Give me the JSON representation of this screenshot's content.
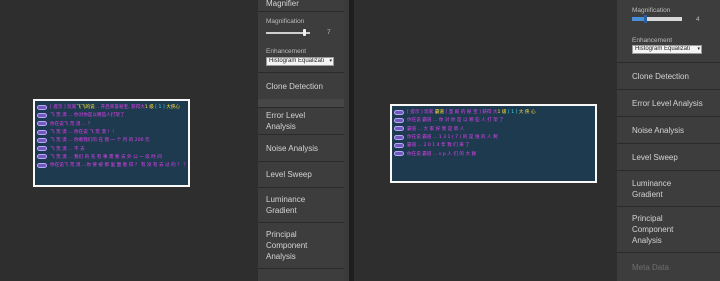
{
  "left_panel": {
    "header_partial": "Magnifier",
    "magnification": {
      "label": "Magnification",
      "value": "7"
    },
    "enhancement": {
      "label": "Enhancement",
      "selected": "Histogram Equalizati"
    },
    "tools": [
      "Clone Detection",
      "Error Level Analysis",
      "Noise Analysis",
      "Level Sweep",
      "Luminance Gradient",
      "Principal Component Analysis"
    ]
  },
  "right_panel": {
    "magnification": {
      "label": "Magnification",
      "value": "4"
    },
    "enhancement": {
      "label": "Enhancement",
      "selected": "Histogram Equalizati"
    },
    "tools": [
      "Clone Detection",
      "Error Level Analysis",
      "Noise Analysis",
      "Level Sweep",
      "Luminance Gradient",
      "Principal Component Analysis",
      "Meta Data"
    ]
  },
  "left_magnifier": {
    "lines": [
      {
        "a": "[ 提示 ] 玩家",
        "b": "飞飞的说",
        "c": "... 开启荣誉秘宝, 获得大",
        "d": "1 级",
        "e": " [ 1 ] ",
        "f": "大侠心"
      },
      {
        "a": "飞 荒 漠 ... ",
        "b": "",
        "c": "你对你是以哪些人打架了",
        "d": "",
        "e": "",
        "f": ""
      },
      {
        "a": "你在说飞 荒 漠 ...",
        "b": "",
        "c": "  ？",
        "d": "",
        "e": "",
        "f": ""
      },
      {
        "a": "飞 荒 漠 ... ",
        "b": "",
        "c": "你在说 飞 荒 漠 ！！",
        "d": "",
        "e": "",
        "f": ""
      },
      {
        "a": "飞 荒 漠 ... ",
        "b": "",
        "c": "你看我们的 在 我 一 个 月 的 200 元",
        "d": "",
        "e": "",
        "f": ""
      },
      {
        "a": "飞 荒 漠 ... ",
        "b": "",
        "c": "  不 去",
        "d": "",
        "e": "",
        "f": ""
      },
      {
        "a": "飞 荒 漠 ... ",
        "b": "",
        "c": "我们 的 先 有 事 需 要 去 外 公 一 段 时 间",
        "d": "",
        "e": "",
        "f": ""
      },
      {
        "a": "你在说飞 荒 漠 ...",
        "b": "",
        "c": "你 要 被 那 里 面 看 得 ？ 有 没 有 去 过 的 ？ ？ ？",
        "d": "",
        "e": "",
        "f": ""
      }
    ]
  },
  "right_magnifier": {
    "lines": [
      {
        "a": "[ 提示 ] 玩家 ",
        "b": "霸道",
        "c": " [ 圣 殿 的 秘 宝 ] 获得 大",
        "d": "1 级",
        "e": " [ 1 ] ",
        "f": "大 侠 心"
      },
      {
        "a": "你在说 霸道 ... ",
        "b": "",
        "c": "你 对 你 是 以 哪 些 人 打 架 了",
        "d": "",
        "e": "",
        "f": ""
      },
      {
        "a": "霸道 ... ",
        "b": "",
        "c": "大 家 好 我 是 新 人",
        "d": "",
        "e": "",
        "f": ""
      },
      {
        "a": "你在说 霸道 ... ",
        "b": "",
        "c": "1 3 1 ( 7 ) 的 是 谁 的 人 啊",
        "d": "",
        "e": "",
        "f": ""
      },
      {
        "a": "霸道 ... ",
        "b": "",
        "c": "2 0 1 4 年 我 们 来 了",
        "d": "",
        "e": "",
        "f": ""
      },
      {
        "a": "你在说 霸道 ... ",
        "b": "",
        "c": "v p 人 们 的 大 群",
        "d": "",
        "e": "",
        "f": ""
      }
    ]
  },
  "colors": {
    "tag_fill": "#7058b8",
    "chat_magenta": "#e040f0",
    "chat_yellow": "#ffe040",
    "chat_cyan": "#40e0f0",
    "magnifier_bg": "#1e3a4e"
  }
}
